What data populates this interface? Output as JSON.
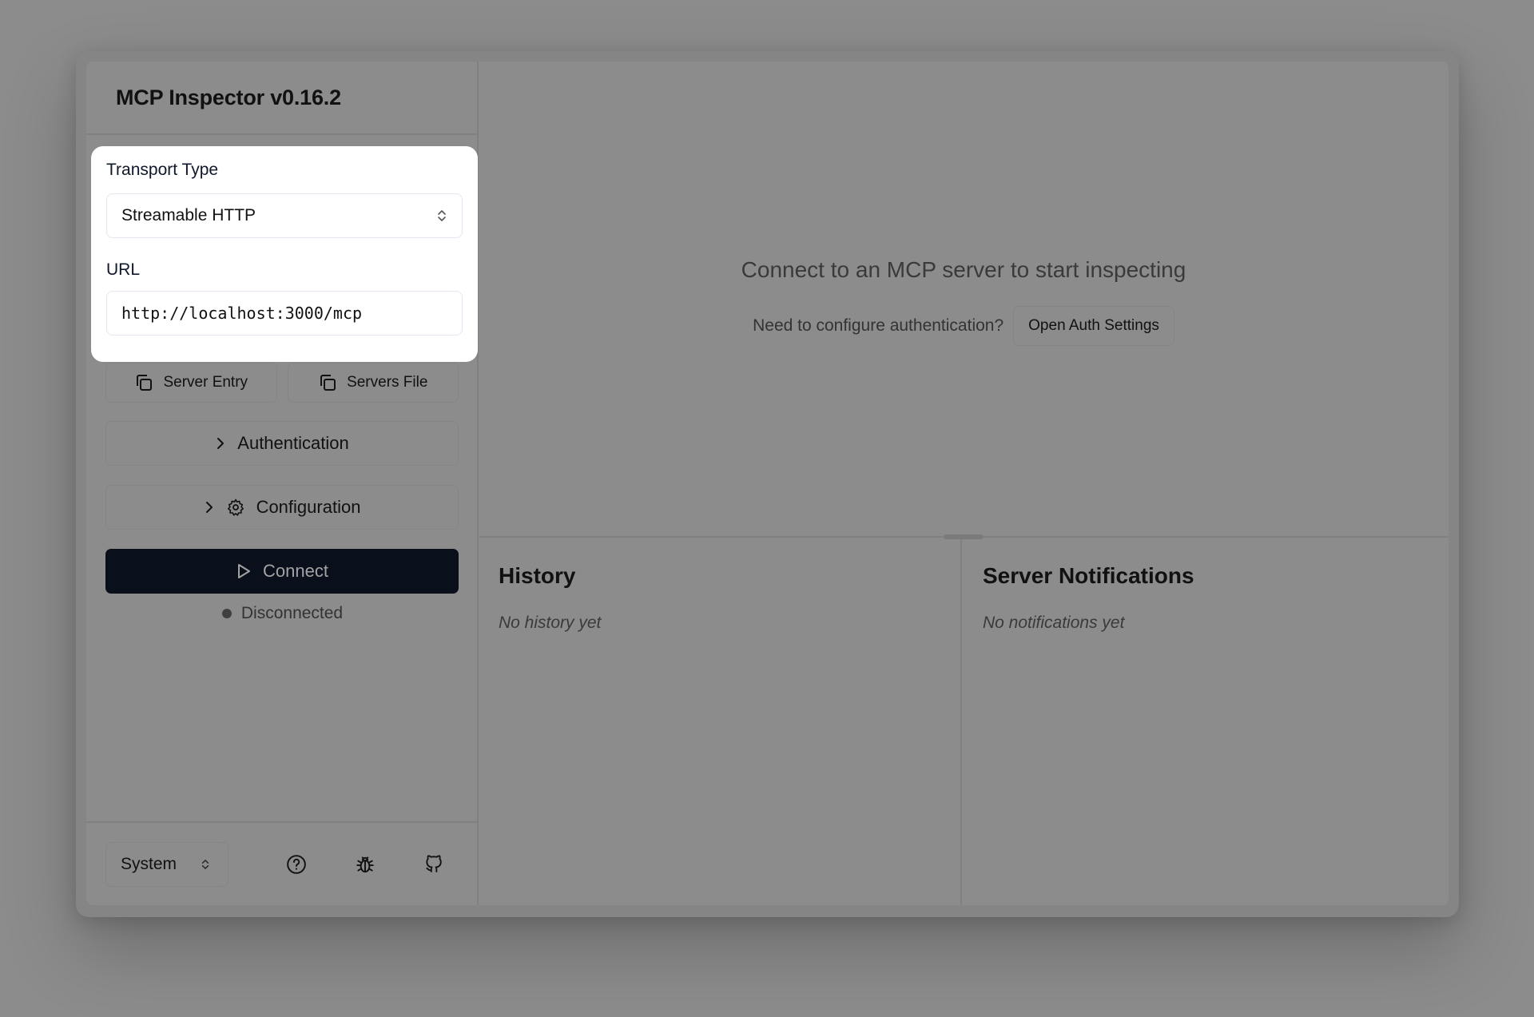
{
  "app": {
    "title": "MCP Inspector v0.16.2"
  },
  "sidebar": {
    "transport_label": "Transport Type",
    "transport_value": "Streamable HTTP",
    "url_label": "URL",
    "url_value": "http://localhost:3000/mcp",
    "server_entry_label": "Server Entry",
    "servers_file_label": "Servers File",
    "authentication_label": "Authentication",
    "configuration_label": "Configuration",
    "connect_label": "Connect",
    "status_text": "Disconnected",
    "theme_value": "System"
  },
  "main": {
    "empty_title": "Connect to an MCP server to start inspecting",
    "auth_prompt": "Need to configure authentication?",
    "auth_button": "Open Auth Settings"
  },
  "history": {
    "title": "History",
    "empty": "No history yet"
  },
  "notifications": {
    "title": "Server Notifications",
    "empty": "No notifications yet"
  },
  "icons": {
    "copy": "copy-icon",
    "chevron": "chevron-right-icon",
    "gear": "gear-icon",
    "play": "play-icon",
    "help": "help-circle-icon",
    "bug": "bug-icon",
    "github": "github-icon"
  },
  "colors": {
    "connect_bg": "#0a0f1c",
    "highlight_bg": "#ffffff",
    "overlay": "#8c8c8c"
  }
}
